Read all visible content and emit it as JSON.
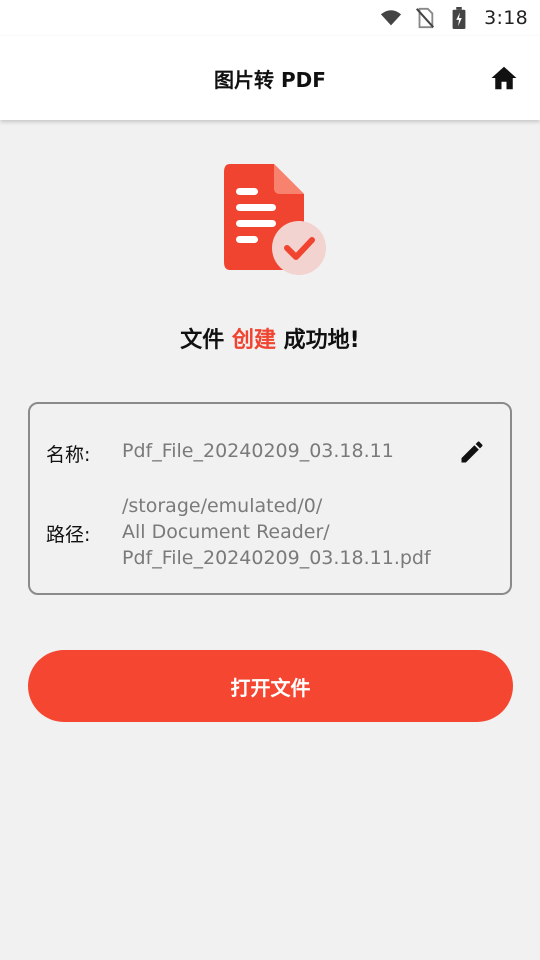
{
  "status_bar": {
    "time": "3:18",
    "icons": [
      "wifi-icon",
      "no-sim-icon",
      "battery-charging-icon"
    ]
  },
  "app_bar": {
    "title": "图片转 PDF",
    "home_icon": "home-icon"
  },
  "illustration": {
    "icon": "pdf-document-check-icon",
    "colors": {
      "primary": "#f04430",
      "badge": "#f2d3cf",
      "check": "#f04430"
    }
  },
  "success_message": {
    "prefix": "文件",
    "highlight": "创建",
    "suffix": "成功地!"
  },
  "file_info": {
    "name_label": "名称:",
    "name_value": "Pdf_File_20240209_03.18.11",
    "path_label": "路径:",
    "path_lines": [
      "/storage/emulated/0/",
      "All Document Reader/",
      "Pdf_File_20240209_03.18.11.pdf"
    ],
    "edit_icon": "pencil-icon"
  },
  "actions": {
    "open_label": "打开文件"
  },
  "colors": {
    "accent": "#f44630",
    "background": "#f1f1f1",
    "muted_text": "#7a7a7a"
  }
}
